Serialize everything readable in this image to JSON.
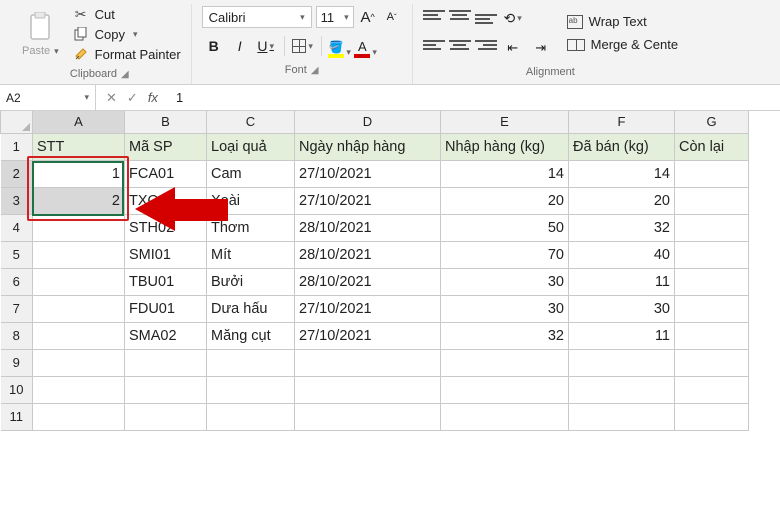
{
  "ribbon": {
    "clipboard": {
      "paste": "Paste",
      "cut": "Cut",
      "copy": "Copy",
      "format_painter": "Format Painter",
      "group": "Clipboard"
    },
    "font": {
      "name": "Calibri",
      "size": "11",
      "bold": "B",
      "italic": "I",
      "underline": "U",
      "grow": "A",
      "shrink": "A",
      "fontcolor_letter": "A",
      "group": "Font"
    },
    "alignment": {
      "wrap": "Wrap Text",
      "merge": "Merge & Cente",
      "group": "Alignment"
    }
  },
  "namebox": "A2",
  "formula": "1",
  "columns": [
    "A",
    "B",
    "C",
    "D",
    "E",
    "F",
    "G"
  ],
  "rows": [
    "1",
    "2",
    "3",
    "4",
    "5",
    "6",
    "7",
    "8",
    "9",
    "10",
    "11"
  ],
  "headers": {
    "stt": "STT",
    "ma": "Mã SP",
    "loai": "Loại quả",
    "ngay": "Ngày nhập hàng",
    "nhap": "Nhập hàng (kg)",
    "ban": "Đã bán (kg)",
    "con": "Còn lại"
  },
  "data": [
    {
      "stt": "1",
      "ma": "FCA01",
      "loai": "Cam",
      "ngay": "27/10/2021",
      "nhap": "14",
      "ban": "14"
    },
    {
      "stt": "2",
      "ma": "TXO",
      "loai": "Xoài",
      "ngay": "27/10/2021",
      "nhap": "20",
      "ban": "20"
    },
    {
      "stt": "",
      "ma": "STH02",
      "loai": "Thơm",
      "ngay": "28/10/2021",
      "nhap": "50",
      "ban": "32"
    },
    {
      "stt": "",
      "ma": "SMI01",
      "loai": "Mít",
      "ngay": "28/10/2021",
      "nhap": "70",
      "ban": "40"
    },
    {
      "stt": "",
      "ma": "TBU01",
      "loai": "Bưởi",
      "ngay": "28/10/2021",
      "nhap": "30",
      "ban": "11"
    },
    {
      "stt": "",
      "ma": "FDU01",
      "loai": "Dưa hấu",
      "ngay": "27/10/2021",
      "nhap": "30",
      "ban": "30"
    },
    {
      "stt": "",
      "ma": "SMA02",
      "loai": "Măng cụt",
      "ngay": "27/10/2021",
      "nhap": "32",
      "ban": "11"
    }
  ]
}
